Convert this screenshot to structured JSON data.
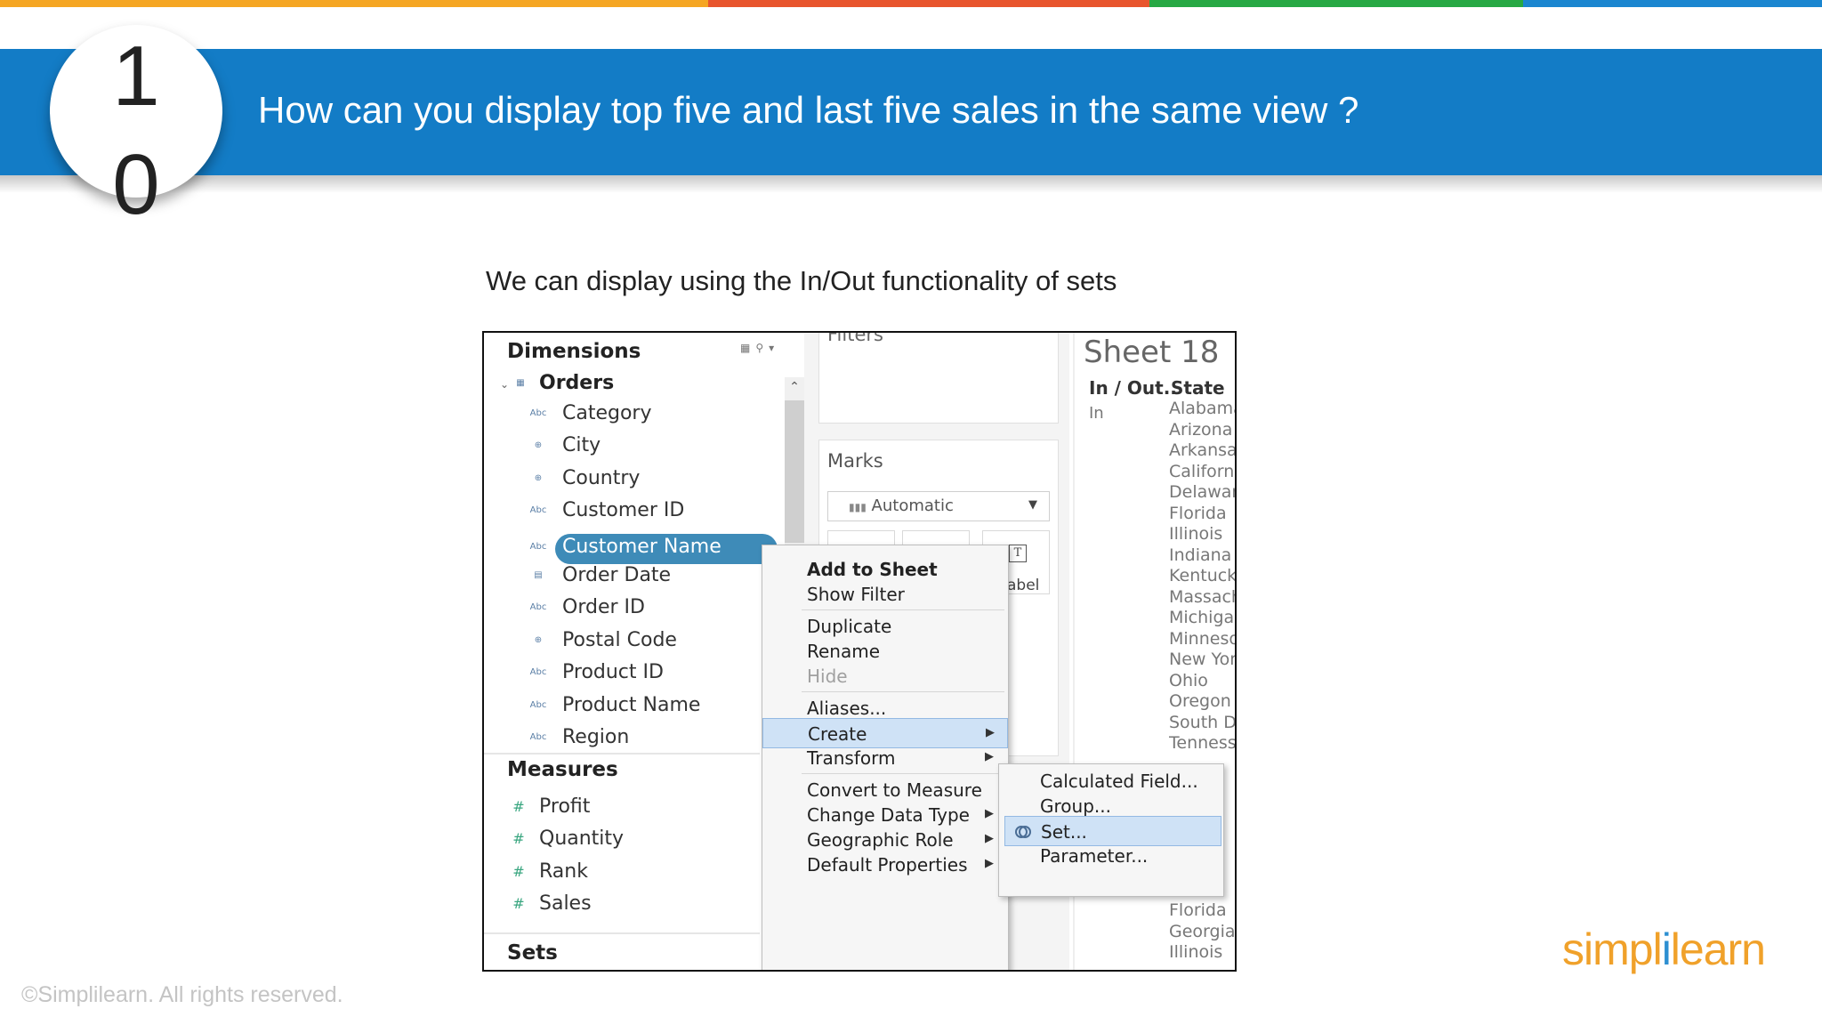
{
  "stripe": [
    "#f5a623",
    "#e8552d",
    "#27a844",
    "#1a86d0"
  ],
  "badge": {
    "digit1": "1",
    "digit2": "0"
  },
  "header": {
    "title": "How can you display top five and last five sales in the same view ?"
  },
  "subtitle": "We can display using the In/Out functionality of sets",
  "data_pane": {
    "dimensions_label": "Dimensions",
    "orders_label": "Orders",
    "dimension_fields": [
      {
        "label": "Category",
        "icon": "abc-icon"
      },
      {
        "label": "City",
        "icon": "globe-icon"
      },
      {
        "label": "Country",
        "icon": "globe-icon"
      },
      {
        "label": "Customer ID",
        "icon": "abc-icon"
      },
      {
        "label": "Customer Name",
        "icon": "abc-icon"
      },
      {
        "label": "Order Date",
        "icon": "calendar-icon"
      },
      {
        "label": "Order ID",
        "icon": "abc-icon"
      },
      {
        "label": "Postal Code",
        "icon": "globe-icon"
      },
      {
        "label": "Product ID",
        "icon": "abc-icon"
      },
      {
        "label": "Product Name",
        "icon": "abc-icon"
      },
      {
        "label": "Region",
        "icon": "abc-icon"
      }
    ],
    "measures_label": "Measures",
    "measure_fields": [
      "Profit",
      "Quantity",
      "Rank",
      "Sales"
    ],
    "sets_label": "Sets"
  },
  "shelves": {
    "filters_label": "Filters",
    "marks_label": "Marks",
    "mark_type": "Automatic",
    "label_button": "abel"
  },
  "sheet": {
    "title": "Sheet 18",
    "col_inout": "In / Out..",
    "col_state": "State",
    "in_value": "In",
    "states": [
      "Alabama",
      "Arizona",
      "Arkansas",
      "California",
      "Delaware",
      "Florida",
      "Illinois",
      "Indiana",
      "Kentucky",
      "Massachusetts",
      "Michigan",
      "Minnesota",
      "New York",
      "Ohio",
      "Oregon",
      "South Dakota",
      "Tennessee"
    ],
    "states_bottom": [
      "Florida",
      "Georgia",
      "Illinois"
    ]
  },
  "context_menu": {
    "items": [
      {
        "label": "Add to Sheet",
        "bold": true
      },
      {
        "label": "Show Filter"
      },
      {
        "label": "Duplicate"
      },
      {
        "label": "Rename"
      },
      {
        "label": "Hide",
        "disabled": true
      },
      {
        "label": "Aliases..."
      },
      {
        "label": "Create",
        "submenu": true,
        "highlighted": true
      },
      {
        "label": "Transform",
        "submenu": true
      },
      {
        "label": "Convert to Measure"
      },
      {
        "label": "Change Data Type",
        "submenu": true
      },
      {
        "label": "Geographic Role",
        "submenu": true
      },
      {
        "label": "Default Properties",
        "submenu": true
      }
    ]
  },
  "sub_menu": {
    "items": [
      {
        "label": "Calculated Field..."
      },
      {
        "label": "Group..."
      },
      {
        "label": "Set...",
        "highlighted": true
      },
      {
        "label": "Parameter..."
      }
    ]
  },
  "footer": {
    "copyright": "©Simplilearn. All rights reserved.",
    "logo_part1": "simpl",
    "logo_part2": "i",
    "logo_part3": "learn"
  }
}
